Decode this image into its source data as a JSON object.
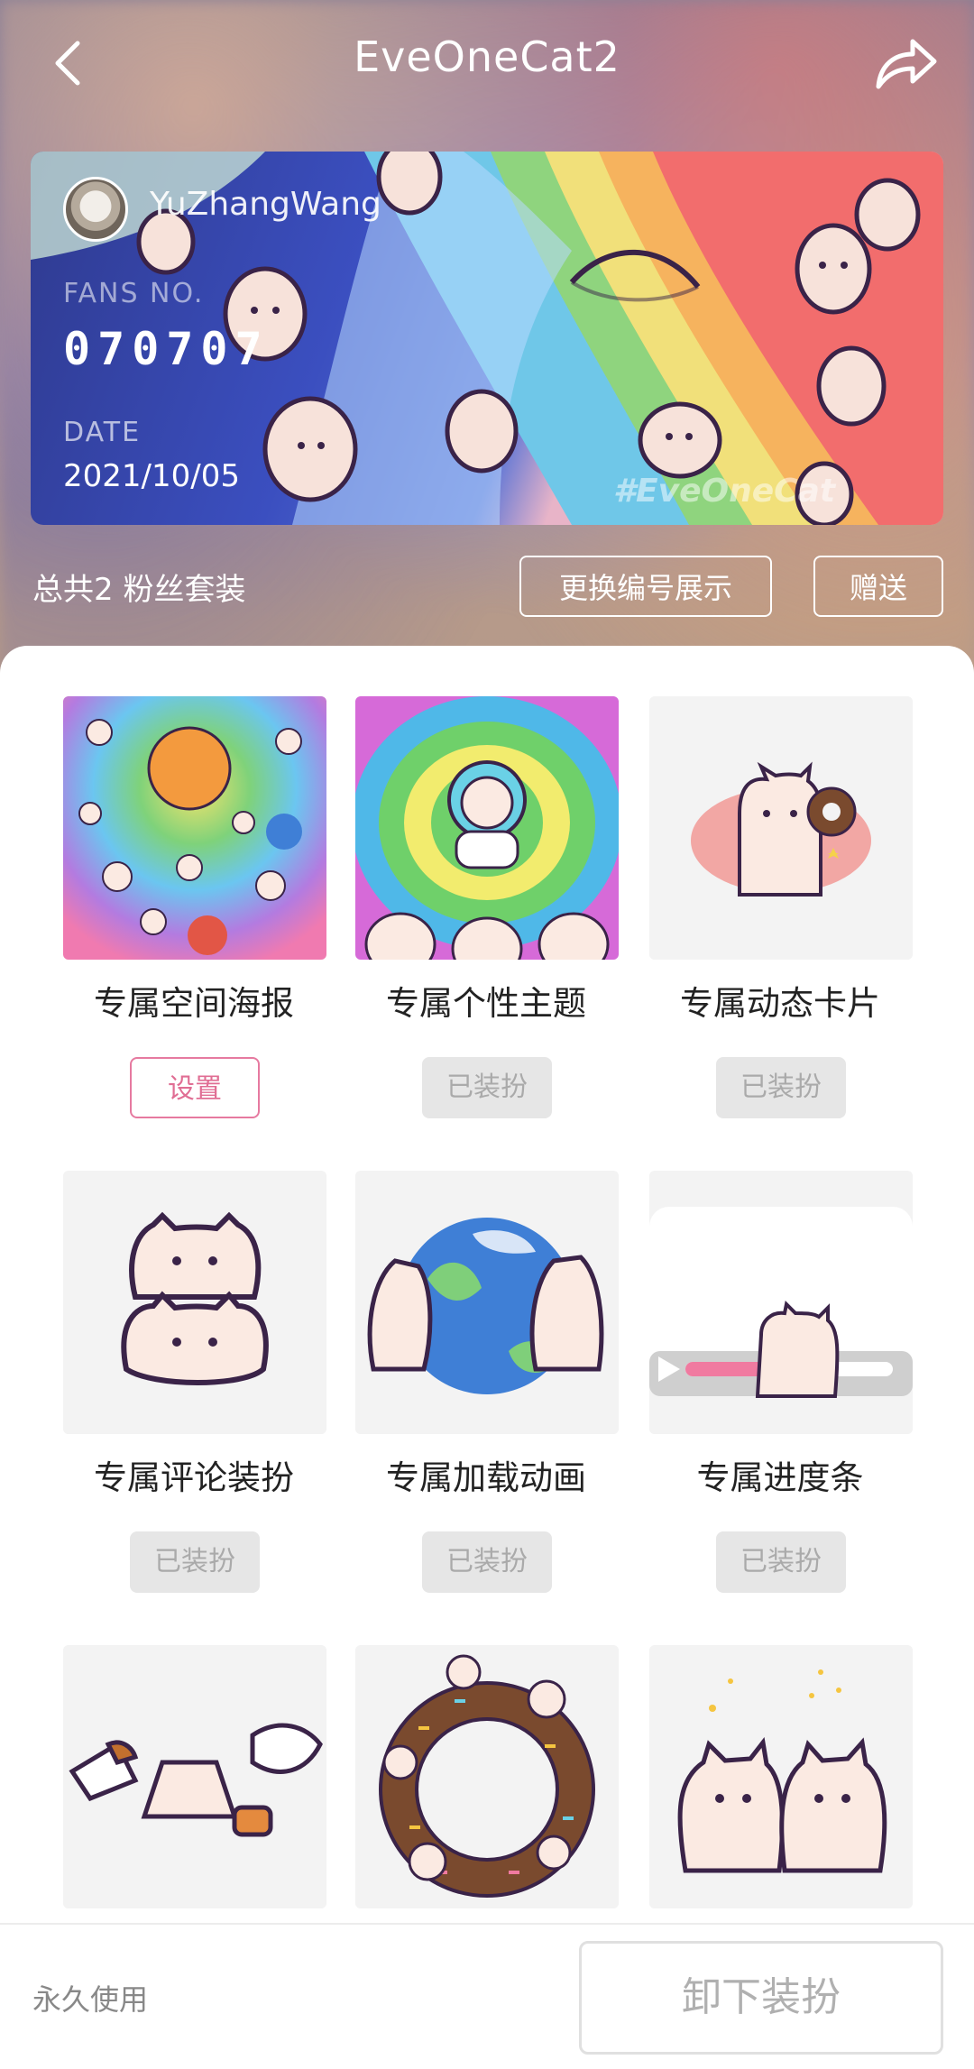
{
  "header": {
    "title": "EveOneCat2",
    "back_icon": "chevron-left-icon",
    "share_icon": "share-arrow-icon"
  },
  "fan_card": {
    "username": "YuZhangWang",
    "fans_label": "FANS NO.",
    "fans_no": "070707",
    "date_label": "DATE",
    "date": "2021/10/05",
    "watermark": "#EveOneCat"
  },
  "summary": {
    "count_text": "总共2 粉丝套装",
    "change_button": "更换编号展示",
    "gift_button": "赠送"
  },
  "items": [
    {
      "label": "专属空间海报",
      "state": "设置",
      "state_type": "set",
      "art": "poster"
    },
    {
      "label": "专属个性主题",
      "state": "已装扮",
      "state_type": "worn",
      "art": "theme"
    },
    {
      "label": "专属动态卡片",
      "state": "已装扮",
      "state_type": "worn",
      "art": "card"
    },
    {
      "label": "专属评论装扮",
      "state": "已装扮",
      "state_type": "worn",
      "art": "comment"
    },
    {
      "label": "专属加载动画",
      "state": "已装扮",
      "state_type": "worn",
      "art": "loading"
    },
    {
      "label": "专属进度条",
      "state": "已装扮",
      "state_type": "worn",
      "art": "progress"
    },
    {
      "label": "",
      "state": "",
      "state_type": "",
      "art": "snacks"
    },
    {
      "label": "",
      "state": "",
      "state_type": "",
      "art": "donut"
    },
    {
      "label": "",
      "state": "",
      "state_type": "",
      "art": "pair"
    }
  ],
  "footer": {
    "perm_text": "永久使用",
    "unequip_button": "卸下装扮"
  },
  "colors": {
    "accent_pink": "#e06e94",
    "worn_bg": "#e6e6e6"
  }
}
